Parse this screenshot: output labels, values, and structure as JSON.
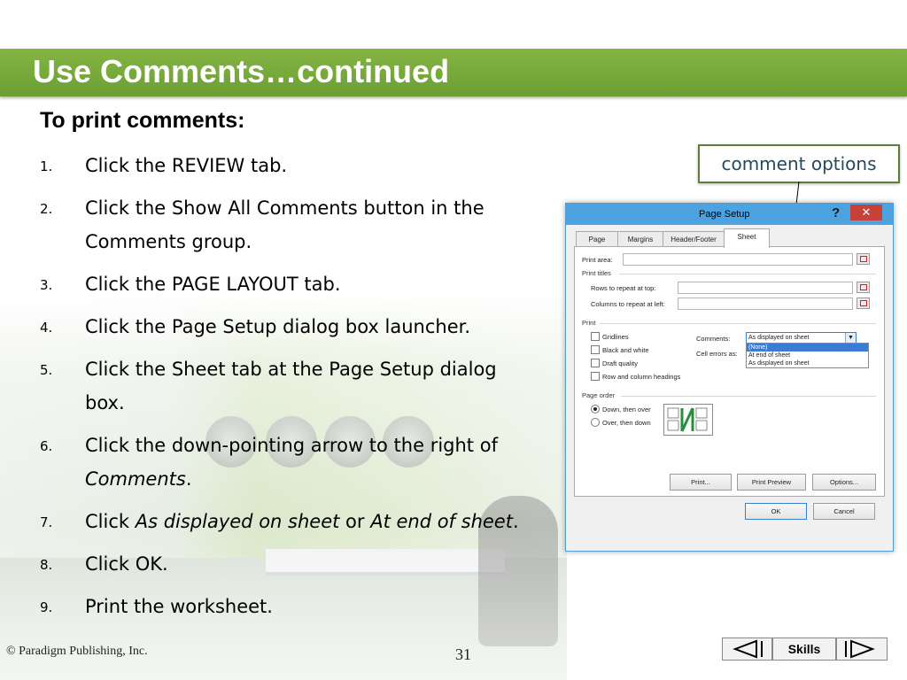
{
  "slide": {
    "title": "Use Comments…continued",
    "subheading": "To print comments:",
    "steps": [
      {
        "num": "1.",
        "text": "Click the REVIEW tab."
      },
      {
        "num": "2.",
        "text": "Click the Show All Comments button in the Comments group."
      },
      {
        "num": "3.",
        "text": "Click the PAGE LAYOUT tab."
      },
      {
        "num": "4.",
        "text": "Click the Page Setup dialog box launcher."
      },
      {
        "num": "5.",
        "text": "Click the Sheet tab at the Page Setup dialog box."
      },
      {
        "num": "6.",
        "text_before": "Click the down-pointing arrow to the right of ",
        "text_italic": "Comments",
        "text_after": "."
      },
      {
        "num": "7.",
        "text_before": "Click ",
        "text_italic": "As displayed on sheet",
        "text_mid": " or ",
        "text_italic2": "At end of sheet",
        "text_after": "."
      },
      {
        "num": "8.",
        "text": "Click OK."
      },
      {
        "num": "9.",
        "text": "Print the worksheet."
      }
    ],
    "callout": "comment options"
  },
  "dialog": {
    "title": "Page Setup",
    "help": "?",
    "close": "✕",
    "tabs": [
      "Page",
      "Margins",
      "Header/Footer",
      "Sheet"
    ],
    "print_area_label": "Print area:",
    "print_titles_label": "Print titles",
    "rows_label": "Rows to repeat at top:",
    "columns_label": "Columns to repeat at left:",
    "print_section_label": "Print",
    "gridlines_label": "Gridlines",
    "black_white_label": "Black and white",
    "draft_label": "Draft quality",
    "row_col_headings_label": "Row and column headings",
    "comments_label": "Comments:",
    "comments_value": "As displayed on sheet",
    "cell_errors_label": "Cell errors as:",
    "comment_options": [
      "(None)",
      "At end of sheet",
      "As displayed on sheet"
    ],
    "page_order_label": "Page order",
    "down_then_over": "Down, then over",
    "over_then_down": "Over, then down",
    "print_button": "Print...",
    "preview_button": "Print Preview",
    "options_button": "Options...",
    "ok_button": "OK",
    "cancel_button": "Cancel"
  },
  "footer": {
    "copyright": "© Paradigm Publishing, Inc.",
    "page_number": "31",
    "skills": "Skills",
    "prev_icon": "triangle-left-icon",
    "next_icon": "triangle-right-icon"
  },
  "colors": {
    "title_bar": "#6b9e33",
    "callout_border": "#5b7f3a",
    "dialog_titlebar": "#4ca3e0",
    "close_button": "#c7413a"
  }
}
